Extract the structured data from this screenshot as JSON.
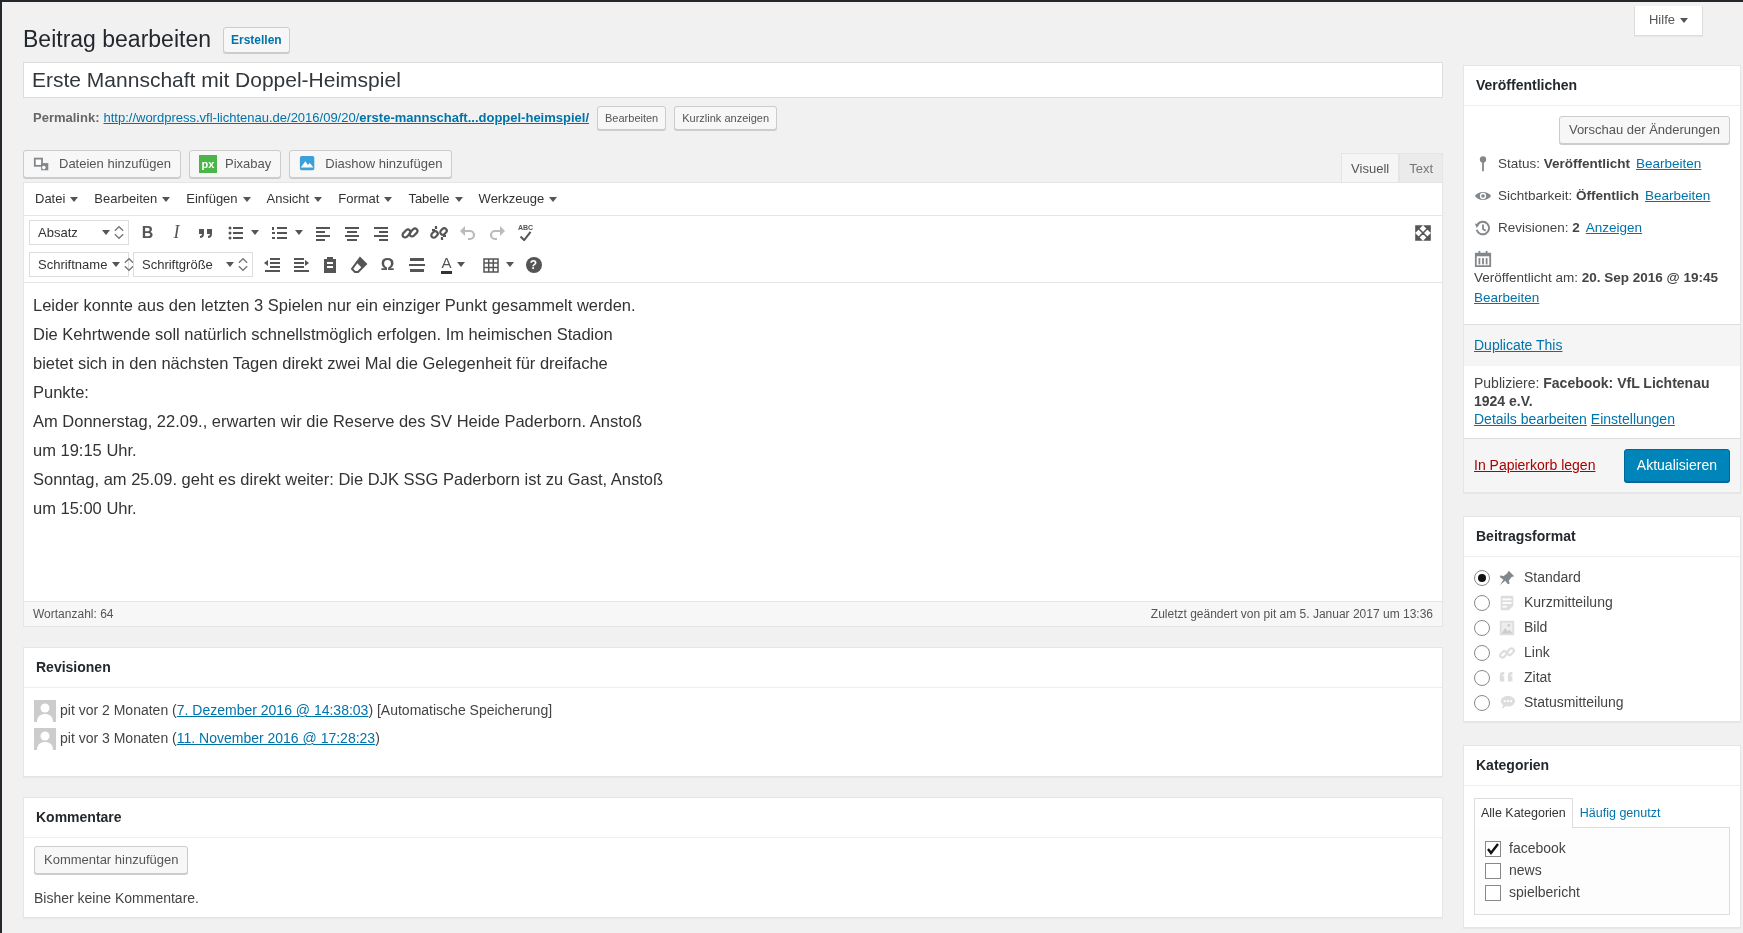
{
  "header": {
    "title": "Beitrag bearbeiten",
    "add_new": "Erstellen",
    "help": "Hilfe"
  },
  "post_title": "Erste Mannschaft mit Doppel-Heimspiel",
  "permalink": {
    "label": "Permalink:",
    "url_base": "http://wordpress.vfl-lichtenau.de/2016/09/20/",
    "url_slug": "erste-mannschaft...doppel-heimspiel/",
    "buttons": [
      "Bearbeiten",
      "Kurzlink anzeigen"
    ]
  },
  "media_buttons": [
    {
      "label": "Dateien hinzufügen",
      "kind": "media"
    },
    {
      "label": "Pixabay",
      "kind": "pixabay",
      "logo_text": "px"
    },
    {
      "label": "Diashow hinzufügen",
      "kind": "slideshow"
    }
  ],
  "editor": {
    "tabs": [
      {
        "label": "Visuell",
        "selected": true
      },
      {
        "label": "Text",
        "selected": false
      }
    ],
    "menus": [
      "Datei",
      "Bearbeiten",
      "Einfügen",
      "Ansicht",
      "Format",
      "Tabelle",
      "Werkzeuge"
    ],
    "toolbar": {
      "format_select": "Absatz",
      "font_select": "Schriftname",
      "size_select": "Schriftgröße",
      "bold": "B",
      "italic": "I",
      "spellcheck": "ABC",
      "special_char": "Ω",
      "text_color": "A",
      "help": "?"
    },
    "lines": [
      "Leider konnte aus den letzten 3 Spielen nur ein einziger Punkt gesammelt werden.",
      "Die Kehrtwende soll natürlich schnellstmöglich erfolgen. Im heimischen Stadion",
      "bietet sich in den nächsten Tagen direkt zwei Mal die Gelegenheit für dreifache",
      "Punkte:",
      "Am Donnerstag, 22.09., erwarten wir die Reserve des SV Heide Paderborn. Anstoß",
      "um 19:15 Uhr.",
      "Sonntag, am 25.09. geht es direkt weiter: Die DJK SSG Paderborn ist zu Gast, Anstoß",
      "um 15:00 Uhr."
    ],
    "word_count": "Wortanzahl: 64",
    "last_edited": "Zuletzt geändert von pit am 5. Januar 2017 um 13:36"
  },
  "revisions": {
    "title": "Revisionen",
    "items": [
      {
        "before": "pit vor 2 Monaten (",
        "link": "7. Dezember 2016 @ 14:38:03",
        "after": ") [Automatische Speicherung]"
      },
      {
        "before": "pit vor 3 Monaten (",
        "link": "11. November 2016 @ 17:28:23",
        "after": ")"
      }
    ]
  },
  "comments": {
    "title": "Kommentare",
    "button": "Kommentar hinzufügen",
    "empty": "Bisher keine Kommentare."
  },
  "publish": {
    "title": "Veröffentlichen",
    "preview": "Vorschau der Änderungen",
    "rows": [
      {
        "kind": "status",
        "text": "Status: **Veröffentlicht**",
        "link": "Bearbeiten"
      },
      {
        "kind": "visibility",
        "text": "Sichtbarkeit: **Öffentlich**",
        "link": "Bearbeiten"
      },
      {
        "kind": "revisions",
        "text": "Revisionen: **2**",
        "link": "Anzeigen"
      },
      {
        "kind": "date",
        "text": "Veröffentlicht am: **20. Sep 2016 @ 19:45**",
        "link": "Bearbeiten"
      }
    ],
    "duplicate": "Duplicate This",
    "publicize": {
      "text": "Publiziere: **Facebook: VfL Lichtenau 1924 e.V.**",
      "links": [
        "Details bearbeiten",
        "Einstellungen"
      ]
    },
    "trash": "In Papierkorb legen",
    "update": "Aktualisieren"
  },
  "formats": {
    "title": "Beitragsformat",
    "items": [
      {
        "kind": "standard",
        "label": "Standard",
        "selected": true
      },
      {
        "kind": "aside",
        "label": "Kurzmitteilung",
        "selected": false
      },
      {
        "kind": "image",
        "label": "Bild",
        "selected": false
      },
      {
        "kind": "link",
        "label": "Link",
        "selected": false
      },
      {
        "kind": "quote",
        "label": "Zitat",
        "selected": false
      },
      {
        "kind": "status",
        "label": "Statusmitteilung",
        "selected": false
      }
    ]
  },
  "categories": {
    "title": "Kategorien",
    "tabs": [
      {
        "label": "Alle Kategorien",
        "selected": true
      },
      {
        "label": "Häufig genutzt",
        "selected": false
      }
    ],
    "items": [
      {
        "label": "facebook",
        "checked": true
      },
      {
        "label": "news",
        "checked": false
      },
      {
        "label": "spielbericht",
        "checked": false
      }
    ]
  }
}
